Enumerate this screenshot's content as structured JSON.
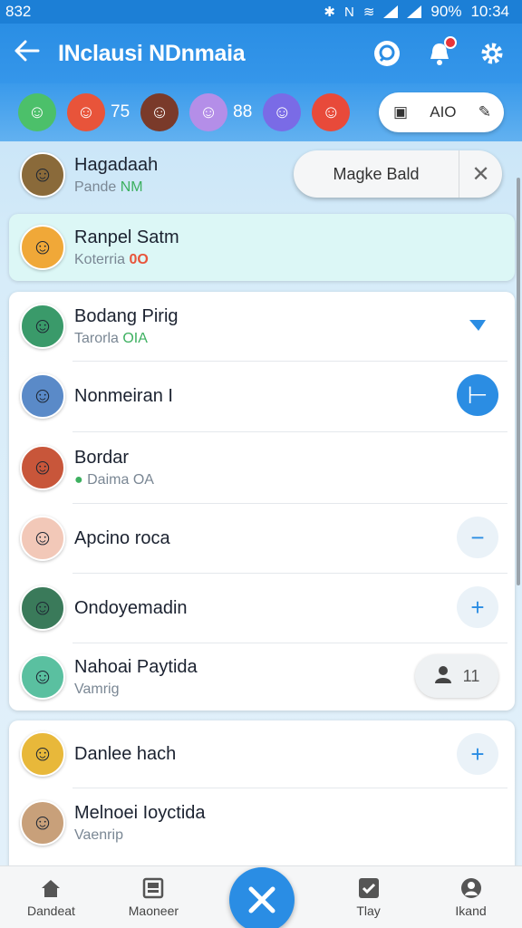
{
  "status_bar": {
    "left": "832",
    "battery": "90%",
    "time": "10:34"
  },
  "app_bar": {
    "title": "INclausi NDnmaia"
  },
  "filter_bar": {
    "chips": [
      {
        "value": "",
        "avatar": "girl",
        "color": "#4cc06a"
      },
      {
        "value": "75",
        "avatar": "red-monster",
        "color": "#e8543a"
      },
      {
        "value": "",
        "avatar": "dark-monster",
        "color": "#7a3a2a"
      },
      {
        "value": "88",
        "avatar": "unicorn",
        "color": "#b48ee8"
      },
      {
        "value": "",
        "avatar": "nk-logo",
        "color": "#7a6be6"
      },
      {
        "value": "",
        "avatar": "gift",
        "color": "#e84a3a"
      }
    ],
    "button_label": "AIO"
  },
  "rows": [
    {
      "name": "Hagadaah",
      "sub": "Pande",
      "sub_extra": "NM",
      "avatar_color": "#8a6a3a",
      "avatar_glyph": "☺"
    },
    {
      "name": "Ranpel Satm",
      "sub": "Koterria",
      "sub_extra": "0O",
      "avatar_color": "#f0a838",
      "avatar_glyph": "☺"
    },
    {
      "name": "Bodang Pirig",
      "sub": "Tarorla",
      "sub_extra": "OIA",
      "avatar_color": "#3a9a6a",
      "avatar_glyph": "☺"
    },
    {
      "name": "Nonmeiran I",
      "sub": "",
      "sub_extra": "",
      "avatar_color": "#5a8ac8",
      "avatar_glyph": "☺"
    },
    {
      "name": "Bordar",
      "sub": "Daima",
      "sub_extra": "OA",
      "avatar_color": "#c8563a",
      "avatar_glyph": "☺"
    },
    {
      "name": "Apcino roca",
      "sub": "",
      "sub_extra": "",
      "avatar_color": "#f2c8b8",
      "avatar_glyph": "☺"
    },
    {
      "name": "Ondoyemadin",
      "sub": "",
      "sub_extra": "",
      "avatar_color": "#3a7a5a",
      "avatar_glyph": "☺"
    },
    {
      "name": "Nahoai Paytida",
      "sub": "Vamrig",
      "sub_extra": "",
      "avatar_color": "#5ac0a0",
      "avatar_glyph": "☺"
    },
    {
      "name": "Danlee hach",
      "sub": "",
      "sub_extra": "",
      "avatar_color": "#e8b83a",
      "avatar_glyph": "☺"
    },
    {
      "name": "Melnoei Ioyctida",
      "sub": "Vaenrip",
      "sub_extra": "",
      "avatar_color": "#c8a07a",
      "avatar_glyph": "☺"
    }
  ],
  "popup": {
    "label": "Magke Bald"
  },
  "pill_count": "11",
  "bottom_nav": [
    {
      "label": "Dandeat",
      "icon": "home-icon"
    },
    {
      "label": "Maoneer",
      "icon": "image-icon"
    },
    {
      "label": "Tlay",
      "icon": "check-icon"
    },
    {
      "label": "Ikand",
      "icon": "person-icon"
    }
  ],
  "colors": {
    "primary": "#2a8de4",
    "highlight_row": "#dcf7f6",
    "badge": "#e8343a"
  }
}
